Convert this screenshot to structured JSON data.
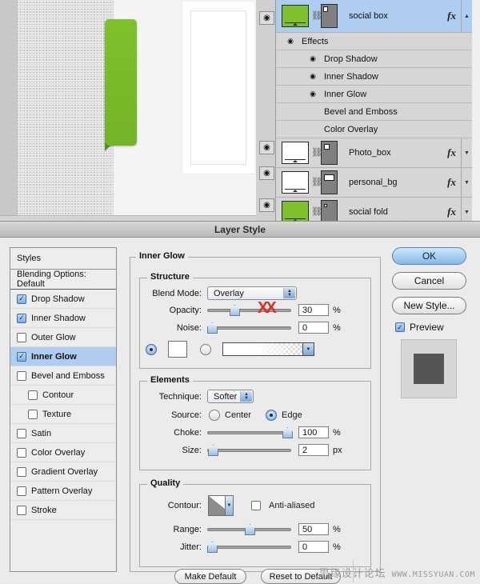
{
  "canvas": {
    "shapes": {
      "green_tab": "green-rounded-tab",
      "green_tab_color": "#7ec12c",
      "fold_color": "#5d8f1f",
      "photo_frame": "white-photo-frame"
    }
  },
  "layers_panel": {
    "rows": [
      {
        "name": "social box",
        "thumb": "green",
        "fx": "fx",
        "chevron": "▲",
        "selected": true,
        "eye": "eye-icon"
      },
      {
        "name": "Photo_box",
        "thumb": "white",
        "fx": "fx",
        "chevron": "▼",
        "selected": false,
        "eye": "eye-icon"
      },
      {
        "name": "personal_bg",
        "thumb": "white",
        "fx": "fx",
        "chevron": "▼",
        "selected": false,
        "eye": "eye-icon"
      },
      {
        "name": "social fold",
        "thumb": "green",
        "fx": "fx",
        "chevron": "▼",
        "selected": false,
        "eye": "eye-icon"
      }
    ],
    "effects_group_label": "Effects",
    "effects": [
      {
        "label": "Drop Shadow",
        "has_eye": true
      },
      {
        "label": "Inner Shadow",
        "has_eye": true
      },
      {
        "label": "Inner Glow",
        "has_eye": true
      },
      {
        "label": "Bevel and Emboss",
        "has_eye": false
      },
      {
        "label": "Color Overlay",
        "has_eye": false
      }
    ]
  },
  "dialog": {
    "title": "Layer Style",
    "styles_list": {
      "header": "Styles",
      "blending_options": "Blending Options: Default",
      "items": [
        {
          "label": "Drop Shadow",
          "checked": true,
          "sub": false,
          "active": false
        },
        {
          "label": "Inner Shadow",
          "checked": true,
          "sub": false,
          "active": false
        },
        {
          "label": "Outer Glow",
          "checked": false,
          "sub": false,
          "active": false
        },
        {
          "label": "Inner Glow",
          "checked": true,
          "sub": false,
          "active": true
        },
        {
          "label": "Bevel and Emboss",
          "checked": false,
          "sub": false,
          "active": false
        },
        {
          "label": "Contour",
          "checked": false,
          "sub": true,
          "active": false
        },
        {
          "label": "Texture",
          "checked": false,
          "sub": true,
          "active": false
        },
        {
          "label": "Satin",
          "checked": false,
          "sub": false,
          "active": false
        },
        {
          "label": "Color Overlay",
          "checked": false,
          "sub": false,
          "active": false
        },
        {
          "label": "Gradient Overlay",
          "checked": false,
          "sub": false,
          "active": false
        },
        {
          "label": "Pattern Overlay",
          "checked": false,
          "sub": false,
          "active": false
        },
        {
          "label": "Stroke",
          "checked": false,
          "sub": false,
          "active": false
        }
      ]
    },
    "panel_title": "Inner Glow",
    "structure": {
      "legend": "Structure",
      "blend_mode_label": "Blend Mode:",
      "blend_mode_value": "Overlay",
      "opacity_label": "Opacity:",
      "opacity_value": "30",
      "opacity_unit": "%",
      "noise_label": "Noise:",
      "noise_value": "0",
      "noise_unit": "%",
      "fill_type": "color",
      "color_swatch": "#ffffff",
      "annotation": "XX"
    },
    "elements": {
      "legend": "Elements",
      "technique_label": "Technique:",
      "technique_value": "Softer",
      "source_label": "Source:",
      "source_center": "Center",
      "source_edge": "Edge",
      "source_selected": "Edge",
      "choke_label": "Choke:",
      "choke_value": "100",
      "choke_unit": "%",
      "size_label": "Size:",
      "size_value": "2",
      "size_unit": "px"
    },
    "quality": {
      "legend": "Quality",
      "contour_label": "Contour:",
      "anti_aliased_label": "Anti-aliased",
      "anti_aliased_checked": false,
      "range_label": "Range:",
      "range_value": "50",
      "range_unit": "%",
      "jitter_label": "Jitter:",
      "jitter_value": "0",
      "jitter_unit": "%"
    },
    "footer": {
      "make_default": "Make Default",
      "reset_to_default": "Reset to Default"
    },
    "buttons": {
      "ok": "OK",
      "cancel": "Cancel",
      "new_style": "New Style...",
      "preview": "Preview",
      "preview_checked": true
    }
  },
  "watermark": {
    "cn": "思缘设计论坛",
    "en": "WWW.MISSYUAN.COM"
  }
}
